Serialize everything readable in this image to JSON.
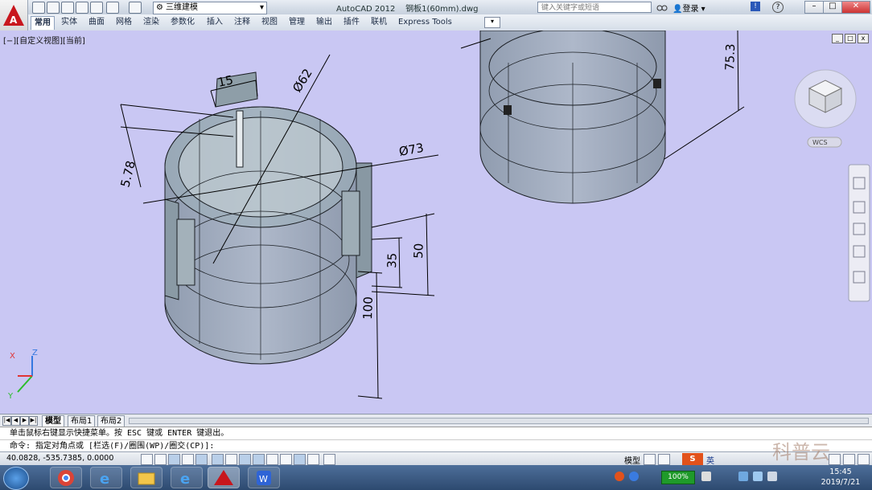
{
  "app": {
    "title": "AutoCAD 2012",
    "filename": "钢板1(60mm).dwg",
    "workspace": "三维建模",
    "search_placeholder": "键入关键字或短语",
    "login": "登录"
  },
  "ribbon_tabs": [
    "常用",
    "实体",
    "曲面",
    "网格",
    "渲染",
    "参数化",
    "插入",
    "注释",
    "视图",
    "管理",
    "输出",
    "插件",
    "联机",
    "Express Tools"
  ],
  "active_tab": "常用",
  "viewport": {
    "label": "[−][自定义视图][当前]",
    "viewcube_wcs": "WCS",
    "axis_labels": {
      "x": "X",
      "y": "Y",
      "z": "Z"
    }
  },
  "dimensions": {
    "d1": "15",
    "d2": "Ø62",
    "d3": "5.78",
    "d4": "Ø73",
    "d5": "35",
    "d6": "50",
    "d7": "100",
    "d8": "75.3"
  },
  "layout_tabs": [
    "模型",
    "布局1",
    "布局2"
  ],
  "command": {
    "history": "单击鼠标右键显示快捷菜单。按 ESC 键或 ENTER 键退出。",
    "prompt": "命令: 指定对角点或 [栏选(F)/圈围(WP)/圈交(CP)]:"
  },
  "status": {
    "coords": "40.0828,   -535.7385,  0.0000",
    "model_label": "模型"
  },
  "taskbar": {
    "battery": "100%",
    "time": "15:45",
    "date": "2019/7/21",
    "ime": "英",
    "watermark": "科普云"
  },
  "colors": {
    "viewport_bg": "#c9c7f3",
    "solid_fill": "#8a9aa6",
    "edge": "#1b1f24",
    "accent_red": "#c8161d"
  }
}
